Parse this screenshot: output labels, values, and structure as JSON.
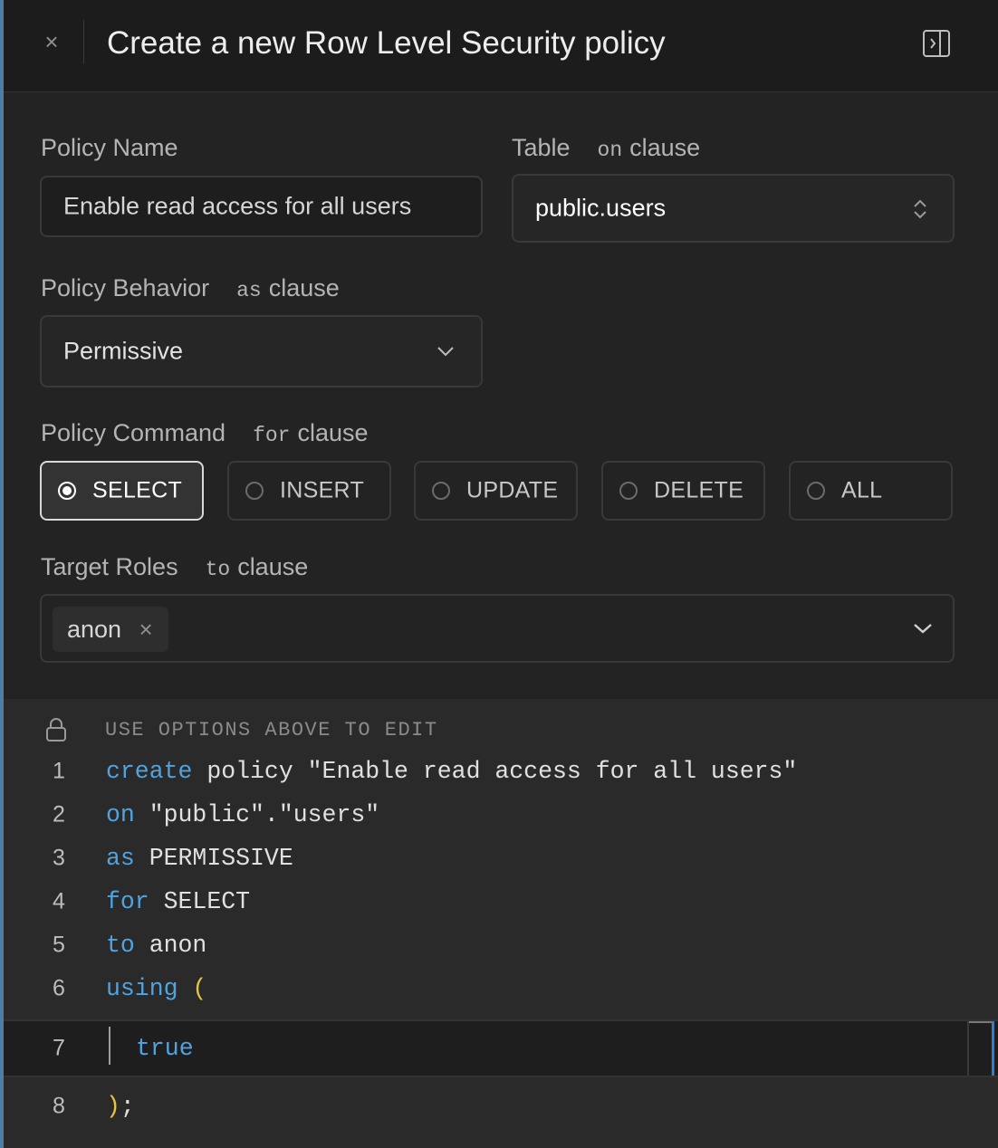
{
  "header": {
    "title": "Create a new Row Level Security policy",
    "close_icon": "close-icon",
    "dock_icon": "panel-dock-icon"
  },
  "form": {
    "policy_name": {
      "label": "Policy Name",
      "value": "Enable read access for all users"
    },
    "table": {
      "label": "Table",
      "keyword": "on",
      "keyword_suffix": "clause",
      "value": "public.users"
    },
    "behavior": {
      "label": "Policy Behavior",
      "keyword": "as",
      "keyword_suffix": "clause",
      "value": "Permissive"
    },
    "command": {
      "label": "Policy Command",
      "keyword": "for",
      "keyword_suffix": "clause",
      "options": [
        "SELECT",
        "INSERT",
        "UPDATE",
        "DELETE",
        "ALL"
      ],
      "selected": "SELECT"
    },
    "roles": {
      "label": "Target Roles",
      "keyword": "to",
      "keyword_suffix": "clause",
      "chips": [
        "anon"
      ]
    }
  },
  "editor": {
    "readonly_note": "USE OPTIONS ABOVE TO EDIT",
    "lines": [
      {
        "num": "1",
        "kw": "create",
        "rest": " policy \"Enable read access for all users\""
      },
      {
        "num": "2",
        "kw": "on",
        "rest": " \"public\".\"users\""
      },
      {
        "num": "3",
        "kw": "as",
        "rest": " PERMISSIVE"
      },
      {
        "num": "4",
        "kw": "for",
        "rest": " SELECT"
      },
      {
        "num": "5",
        "kw": "to",
        "rest": " anon"
      },
      {
        "num": "6",
        "kw": "using",
        "rest": " ("
      },
      {
        "num": "7",
        "kw": "true",
        "rest": ""
      },
      {
        "num": "8",
        "kw": "",
        "rest": ");"
      }
    ]
  },
  "colors": {
    "accent_border": "#4d7ea8",
    "keyword": "#4fa3e0",
    "paren": "#e8c33d"
  }
}
